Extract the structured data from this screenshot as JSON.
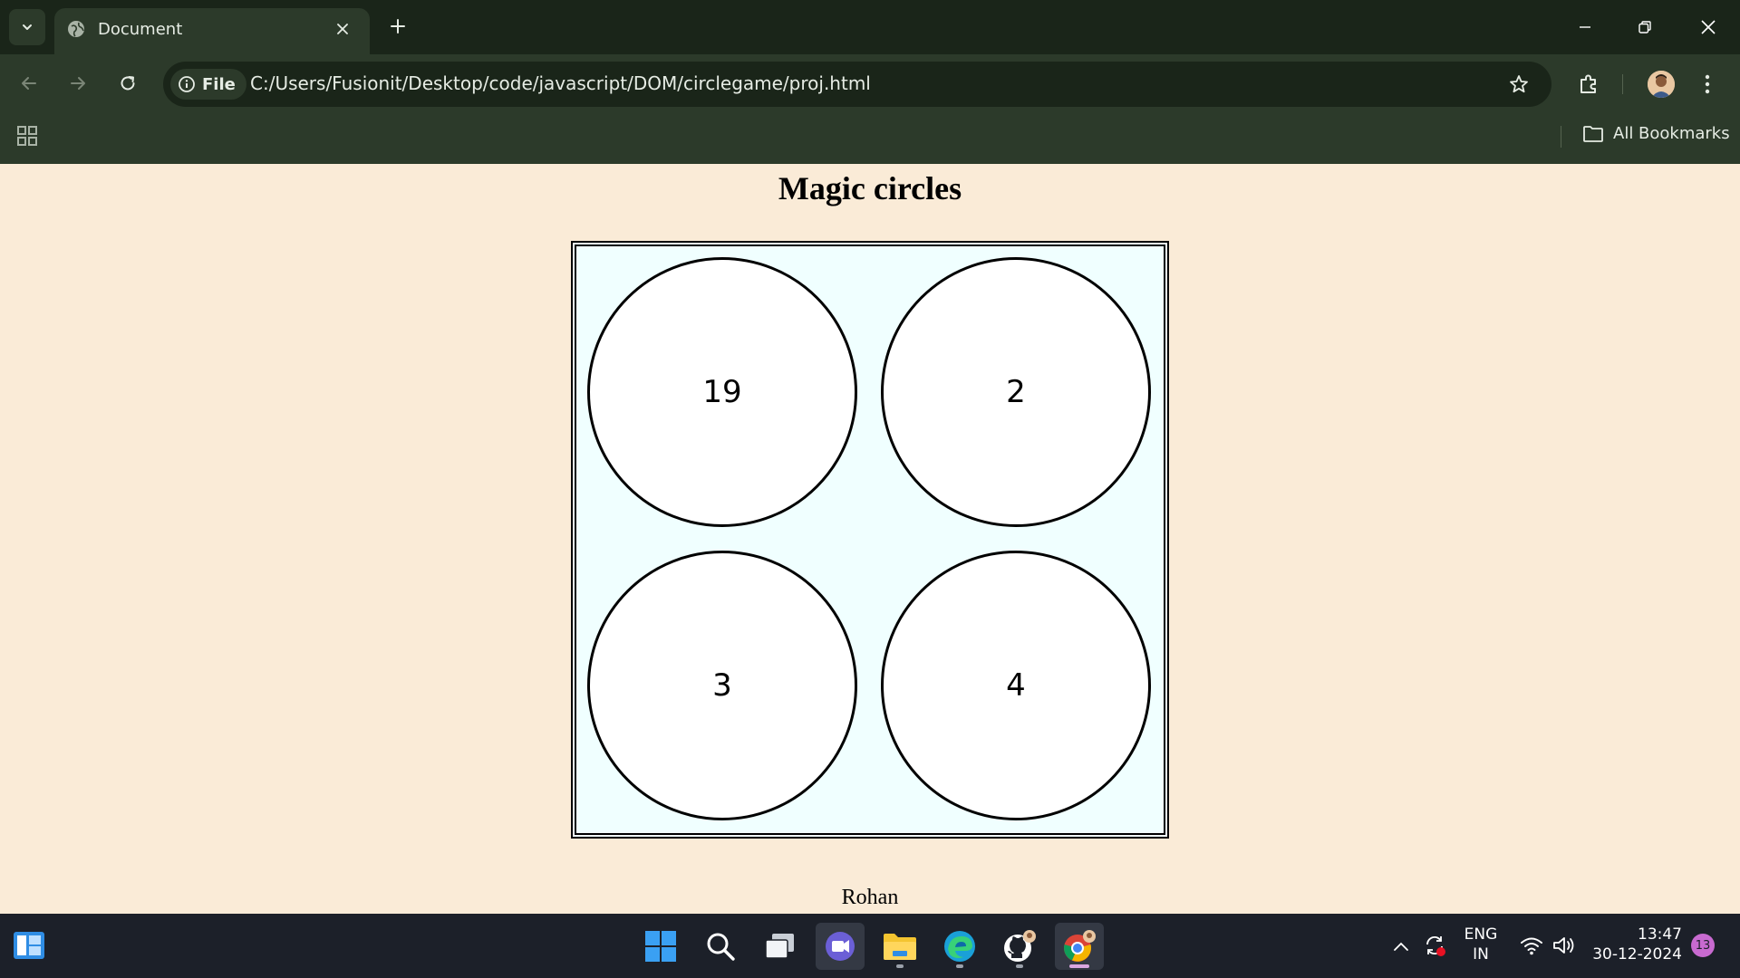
{
  "browser": {
    "tab": {
      "title": "Document"
    },
    "address_bar": {
      "scheme_chip": "File",
      "url": "C:/Users/Fusionit/Desktop/code/javascript/DOM/circlegame/proj.html"
    },
    "bookmarks_bar": {
      "all_bookmarks_label": "All Bookmarks"
    }
  },
  "page": {
    "title": "Magic circles",
    "circles": [
      "19",
      "2",
      "3",
      "4"
    ],
    "footer_name": "Rohan"
  },
  "taskbar": {
    "language": {
      "line1": "ENG",
      "line2": "IN"
    },
    "clock": {
      "time": "13:47",
      "date": "30-12-2024"
    },
    "notification_count": "13"
  },
  "colors": {
    "page_background": "#faebd7",
    "board_background": "#f0ffff",
    "browser_frame": "#2c3a2a",
    "tab_strip": "#1a2519",
    "taskbar": "#1c2029"
  }
}
